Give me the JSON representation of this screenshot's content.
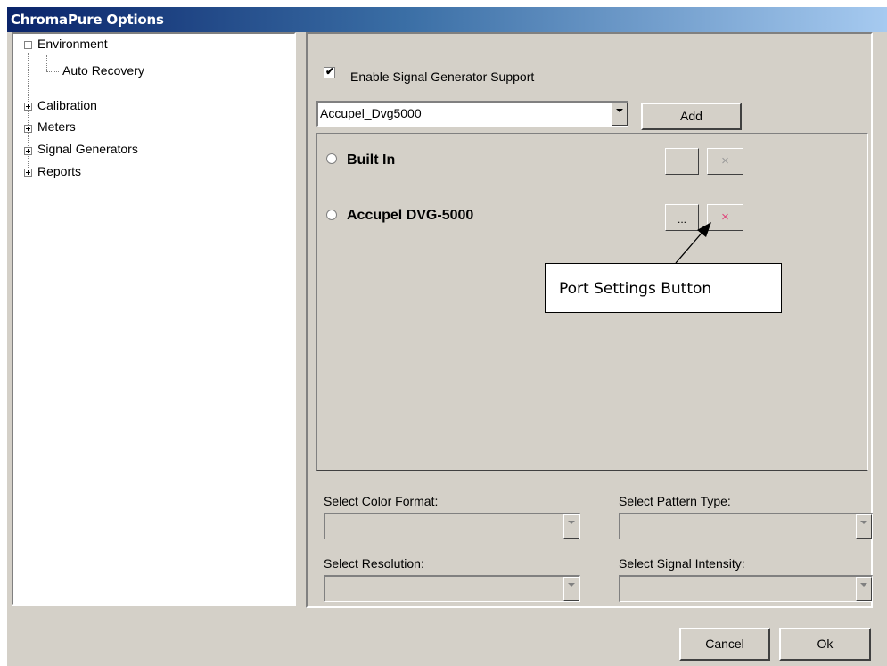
{
  "window": {
    "title": "ChromaPure Options"
  },
  "tree": {
    "items": [
      {
        "label": "Environment",
        "expander": "minus"
      },
      {
        "label": "Auto Recovery",
        "expander": "none"
      },
      {
        "label": "Calibration",
        "expander": "plus"
      },
      {
        "label": "Meters",
        "expander": "plus"
      },
      {
        "label": "Signal Generators",
        "expander": "plus"
      },
      {
        "label": "Reports",
        "expander": "plus"
      }
    ]
  },
  "signal": {
    "enable_label": "Enable Signal Generator Support",
    "enable_checked": true,
    "generator_selected": "Accupel_Dvg5000",
    "add_label": "Add",
    "generators": [
      {
        "name": "Built In",
        "settings_label": "",
        "remove_glyph": "×",
        "remove_enabled": false
      },
      {
        "name": "Accupel DVG-5000",
        "settings_label": "...",
        "remove_glyph": "×",
        "remove_enabled": true
      }
    ]
  },
  "callout": {
    "text": "Port Settings Button"
  },
  "selects": {
    "color_format_label": "Select Color Format:",
    "pattern_type_label": "Select Pattern Type:",
    "resolution_label": "Select Resolution:",
    "signal_intensity_label": "Select Signal Intensity:"
  },
  "footer": {
    "cancel_label": "Cancel",
    "ok_label": "Ok"
  },
  "colors": {
    "remove_active": "#e0457b",
    "remove_disabled": "#9a9a9a",
    "face": "#d4d0c8"
  }
}
